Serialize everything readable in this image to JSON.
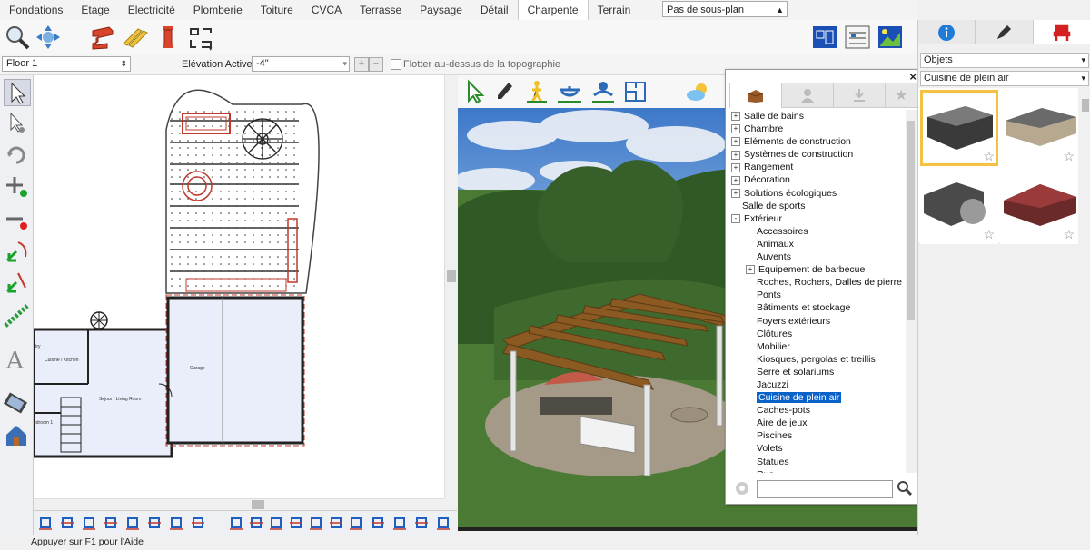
{
  "menu_tabs": [
    "Fondations",
    "Etage",
    "Electricité",
    "Plomberie",
    "Toiture",
    "CVCA",
    "Terrasse",
    "Paysage",
    "Détail",
    "Charpente",
    "Terrain"
  ],
  "active_tab_index": 9,
  "plan_select": "Pas de sous-plan",
  "floor_select": "Floor 1",
  "elevation_label": "Elévation Active:",
  "elevation_value": "-4\"",
  "float_checkbox_label": "Flotter au-dessus de la topographie",
  "plan_labels": {
    "cuisine": "Cuisine / Kitchen",
    "sejour": "Sejour / Living Room",
    "garage": "Garage",
    "bedroom": "edroom 1",
    "try": "try"
  },
  "library": {
    "tree": [
      {
        "label": "Salle de bains",
        "level": 0,
        "expander": "+"
      },
      {
        "label": "Chambre",
        "level": 0,
        "expander": "+"
      },
      {
        "label": "Eléments de construction",
        "level": 0,
        "expander": "+"
      },
      {
        "label": "Systèmes de construction",
        "level": 0,
        "expander": "+"
      },
      {
        "label": "Rangement",
        "level": 0,
        "expander": "+"
      },
      {
        "label": "Décoration",
        "level": 0,
        "expander": "+"
      },
      {
        "label": "Solutions écologiques",
        "level": 0,
        "expander": "+"
      },
      {
        "label": "Salle de sports",
        "level": 0,
        "expander": ""
      },
      {
        "label": "Extérieur",
        "level": 0,
        "expander": "-"
      },
      {
        "label": "Accessoires",
        "level": 1,
        "expander": ""
      },
      {
        "label": "Animaux",
        "level": 1,
        "expander": ""
      },
      {
        "label": "Auvents",
        "level": 1,
        "expander": ""
      },
      {
        "label": "Equipement de barbecue",
        "level": 1,
        "expander": "+"
      },
      {
        "label": "Roches, Rochers, Dalles de pierre",
        "level": 1,
        "expander": ""
      },
      {
        "label": "Ponts",
        "level": 1,
        "expander": ""
      },
      {
        "label": "Bâtiments et stockage",
        "level": 1,
        "expander": ""
      },
      {
        "label": "Foyers extérieurs",
        "level": 1,
        "expander": ""
      },
      {
        "label": "Clôtures",
        "level": 1,
        "expander": ""
      },
      {
        "label": "Mobilier",
        "level": 1,
        "expander": ""
      },
      {
        "label": "Kiosques, pergolas et treillis",
        "level": 1,
        "expander": ""
      },
      {
        "label": "Serre et solariums",
        "level": 1,
        "expander": ""
      },
      {
        "label": "Jacuzzi",
        "level": 1,
        "expander": ""
      },
      {
        "label": "Cuisine de plein air",
        "level": 1,
        "expander": "",
        "selected": true
      },
      {
        "label": "Caches-pots",
        "level": 1,
        "expander": ""
      },
      {
        "label": "Aire de jeux",
        "level": 1,
        "expander": ""
      },
      {
        "label": "Piscines",
        "level": 1,
        "expander": ""
      },
      {
        "label": "Volets",
        "level": 1,
        "expander": ""
      },
      {
        "label": "Statues",
        "level": 1,
        "expander": ""
      },
      {
        "label": "Rue",
        "level": 1,
        "expander": ""
      }
    ],
    "search_value": ""
  },
  "right_panel": {
    "objects_select": "Objets",
    "category_select": "Cuisine de plein air"
  },
  "status_text": "Appuyer sur F1 pour l'Aide",
  "colors": {
    "accent": "#0a62c9",
    "highlight": "#f3c242",
    "wall_red": "#c0392b"
  }
}
